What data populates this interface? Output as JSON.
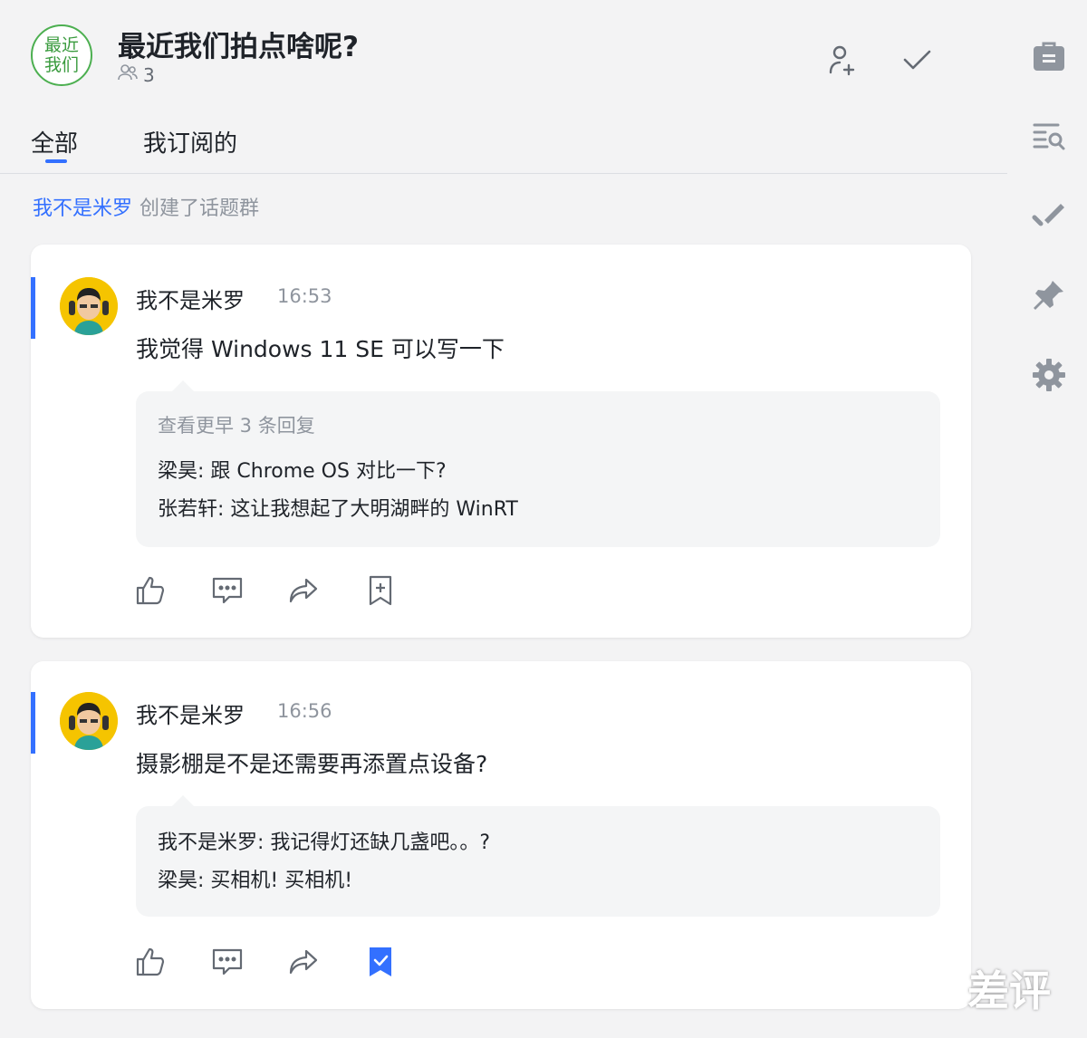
{
  "header": {
    "group_avatar_line1": "最近",
    "group_avatar_line2": "我们",
    "title": "最近我们拍点啥呢?",
    "member_count": "3"
  },
  "tabs": [
    {
      "label": "全部",
      "active": true
    },
    {
      "label": "我订阅的",
      "active": false
    }
  ],
  "system_message": {
    "user": "我不是米罗",
    "text": "创建了话题群"
  },
  "posts": [
    {
      "author": "我不是米罗",
      "time": "16:53",
      "content": "我觉得 Windows 11 SE 可以写一下",
      "more_replies": "查看更早 3 条回复",
      "replies": [
        "梁昊: 跟 Chrome OS 对比一下?",
        "张若轩: 这让我想起了大明湖畔的 WinRT"
      ],
      "bookmarked": false
    },
    {
      "author": "我不是米罗",
      "time": "16:56",
      "content": "摄影棚是不是还需要再添置点设备?",
      "more_replies": "",
      "replies": [
        "我不是米罗: 我记得灯还缺几盏吧。。?",
        "梁昊: 买相机! 买相机!"
      ],
      "bookmarked": true
    }
  ],
  "watermark": "差评",
  "colors": {
    "accent": "#3370ff",
    "group_green": "#4caf50",
    "rail_icon": "#8f959e"
  }
}
